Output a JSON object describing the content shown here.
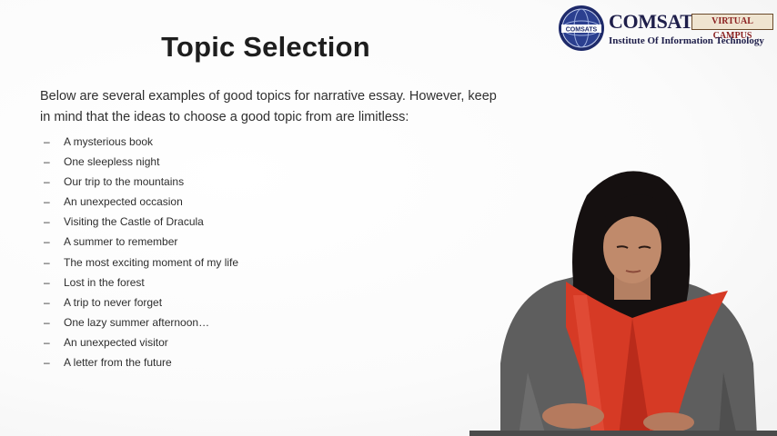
{
  "slide": {
    "title": "Topic Selection",
    "intro": "Below are several examples of good topics for narrative essay. However, keep in mind that the ideas to choose a good topic from are limitless:",
    "bullet_symbol": "–",
    "topics": [
      "A mysterious book",
      "One sleepless night",
      "Our trip to the mountains",
      "An unexpected occasion",
      "Visiting the Castle of Dracula",
      "A summer to remember",
      "The most exciting moment of my life",
      "Lost in the forest",
      "A trip to never forget",
      "One lazy summer afternoon…",
      "An unexpected visitor",
      "A letter from the future"
    ]
  },
  "logo": {
    "seal_text": "COMSATS",
    "name": "COMSATS",
    "badge": "VIRTUAL CAMPUS",
    "subtitle": "Institute Of Information Technology",
    "colors": {
      "navy": "#1e1e4a",
      "badge_text": "#8a1f1f",
      "badge_bg": "#efe4d0"
    }
  },
  "presenter": {
    "colors": {
      "scarf": "#d63a25",
      "sweater": "#5a5a5a",
      "hair": "#151010"
    }
  }
}
